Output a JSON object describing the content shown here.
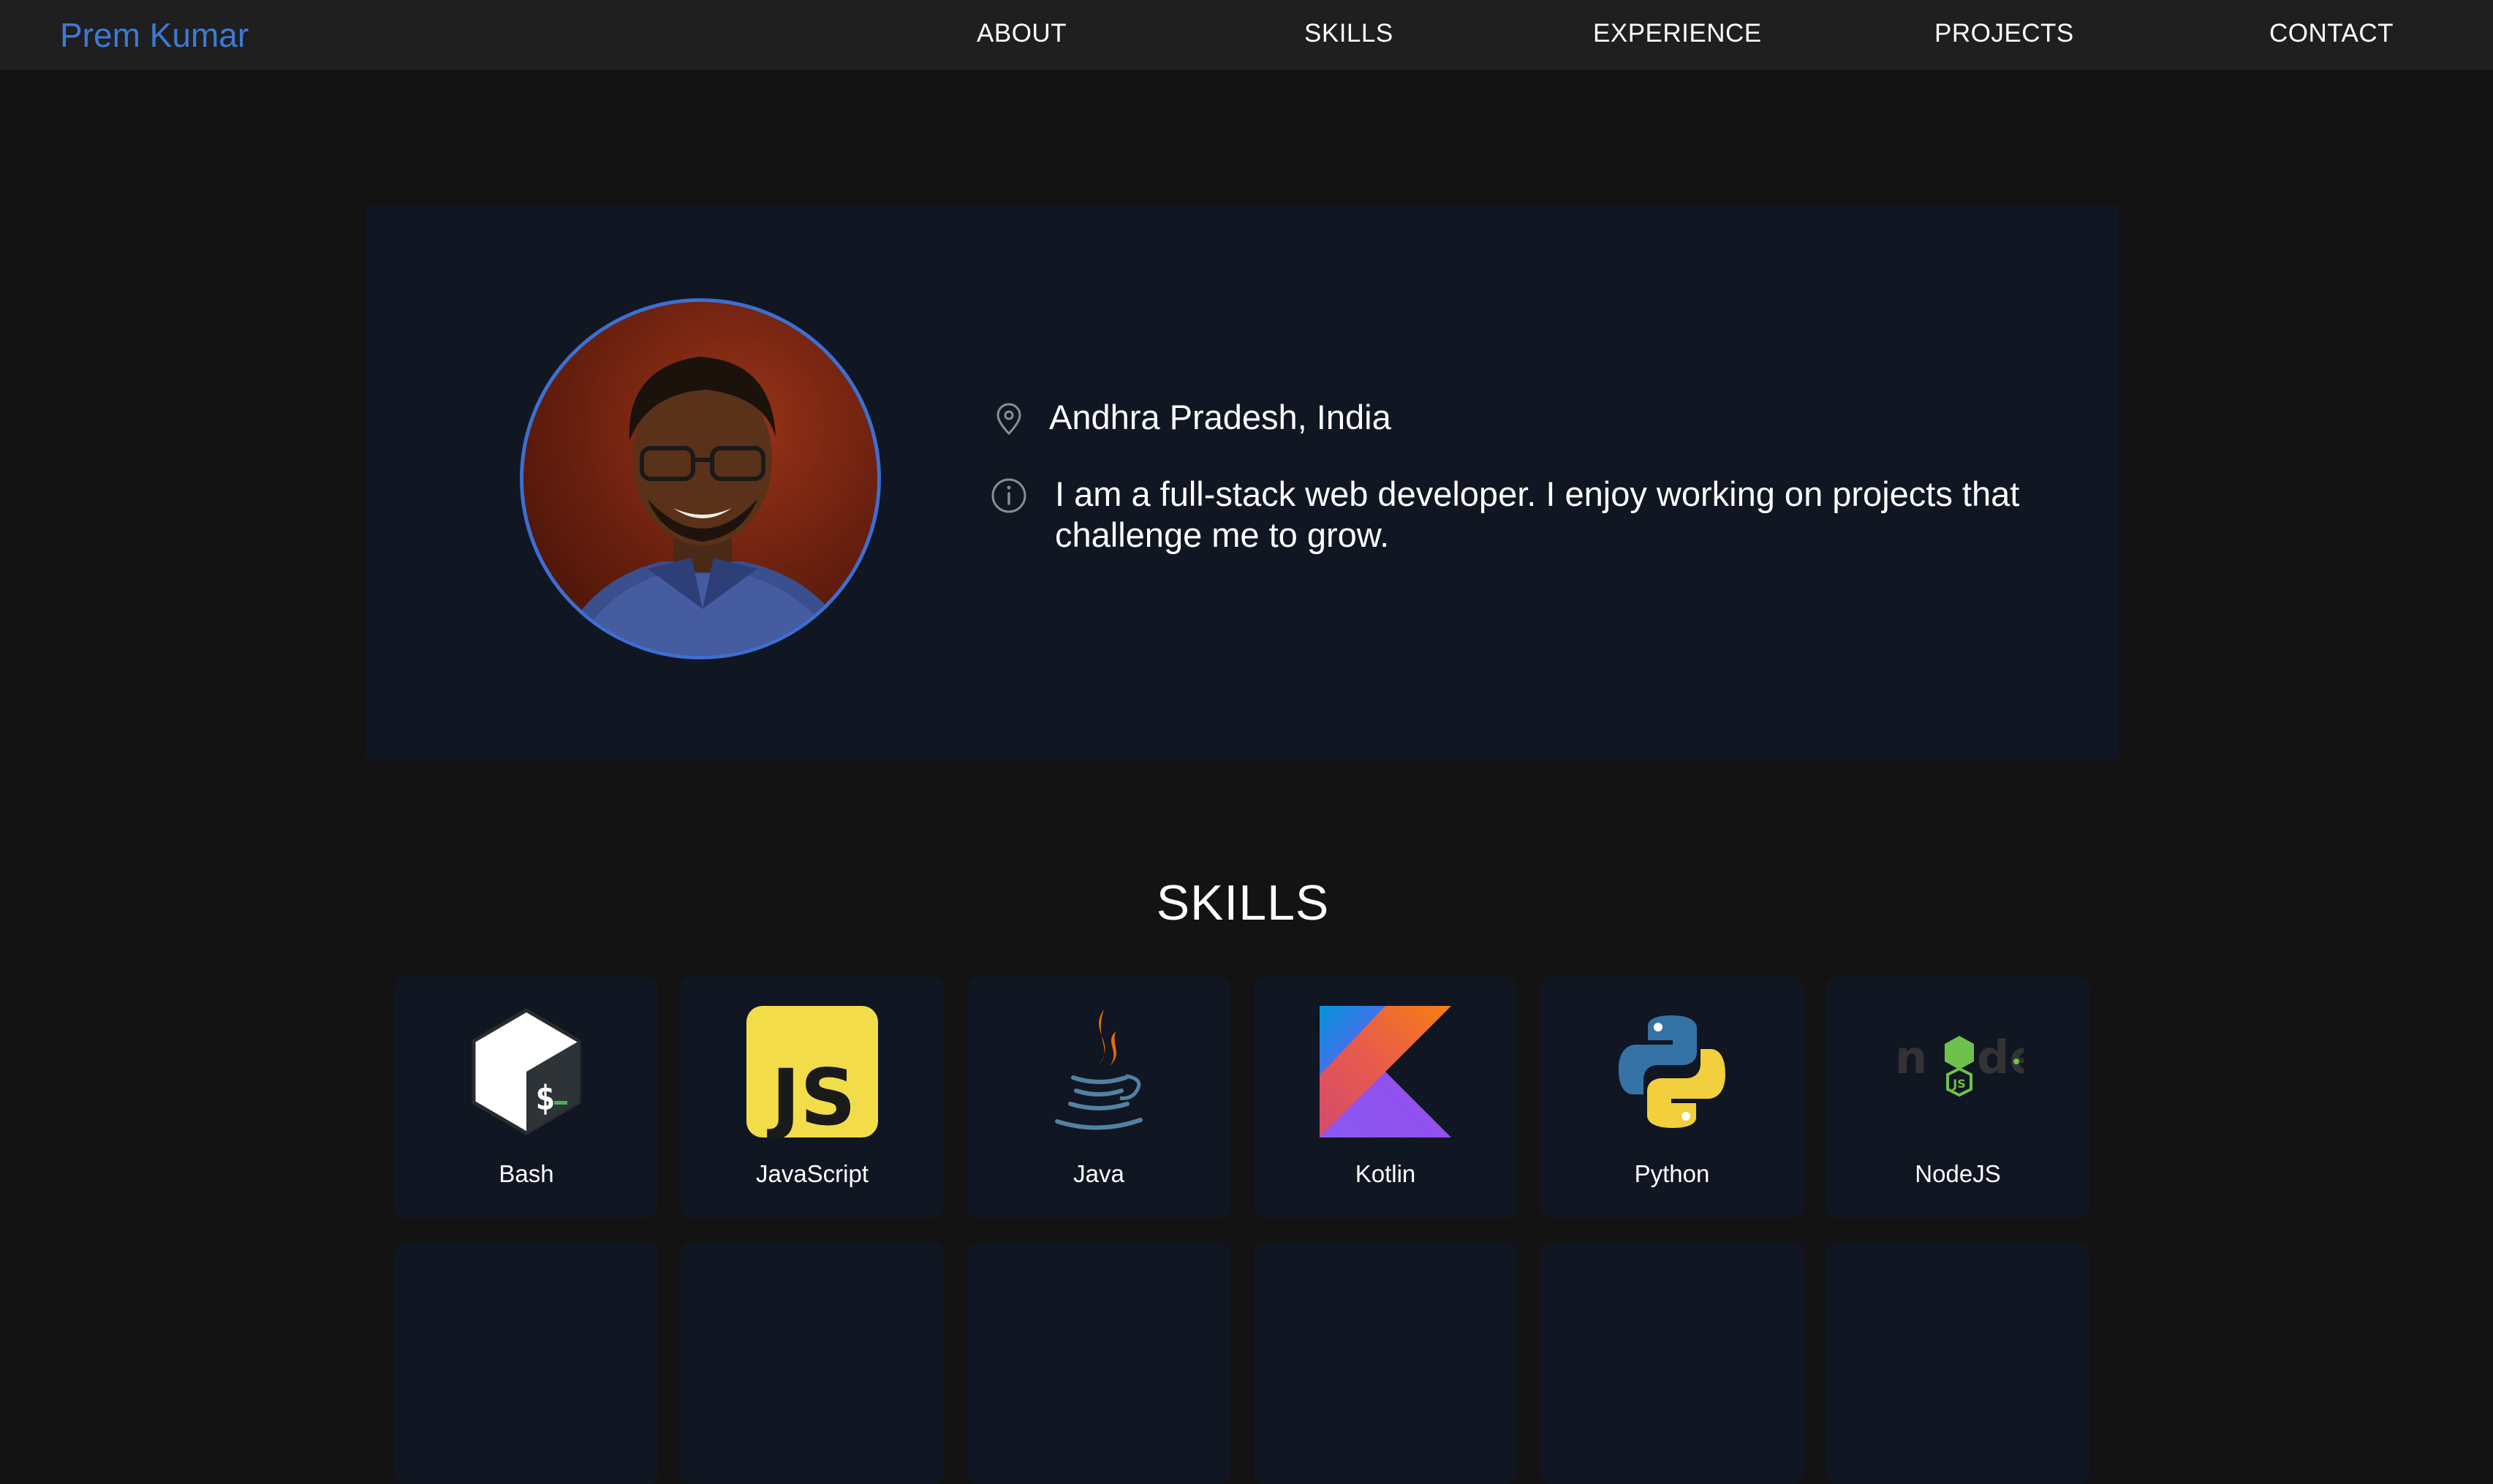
{
  "header": {
    "brand": "Prem Kumar",
    "nav": [
      "ABOUT",
      "SKILLS",
      "EXPERIENCE",
      "PROJECTS",
      "CONTACT"
    ]
  },
  "about": {
    "location": "Andhra Pradesh, India",
    "bio": "I am a full-stack web developer. I enjoy working on projects that challenge me to grow."
  },
  "skills": {
    "title": "SKILLS",
    "items": [
      {
        "name": "Bash",
        "icon": "bash-icon"
      },
      {
        "name": "JavaScript",
        "icon": "javascript-icon"
      },
      {
        "name": "Java",
        "icon": "java-icon"
      },
      {
        "name": "Kotlin",
        "icon": "kotlin-icon"
      },
      {
        "name": "Python",
        "icon": "python-icon"
      },
      {
        "name": "NodeJS",
        "icon": "nodejs-icon"
      }
    ]
  },
  "colors": {
    "background": "#131313",
    "nav_background": "#1f1f1f",
    "card_background": "#111623",
    "accent": "#3d7ad6"
  }
}
